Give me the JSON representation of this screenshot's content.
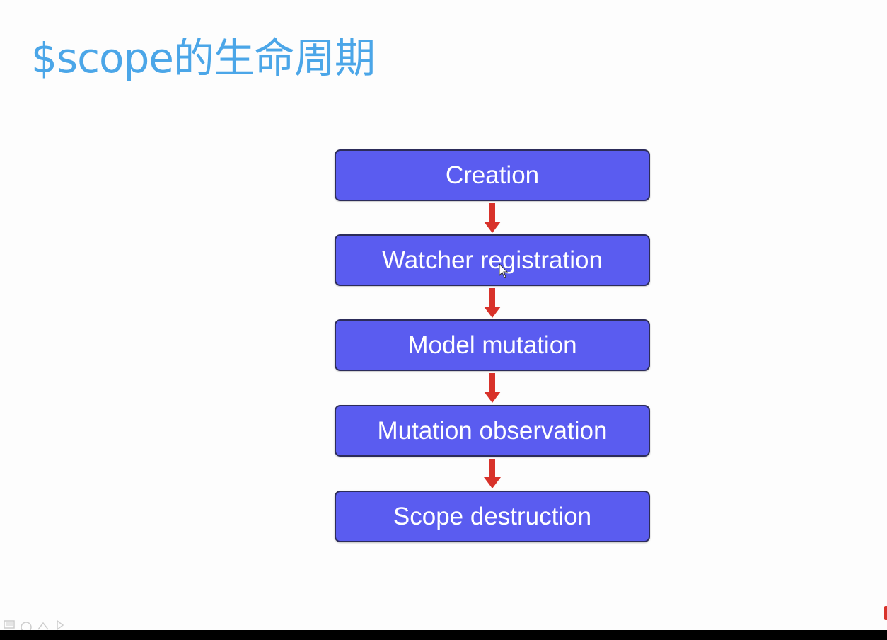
{
  "slide": {
    "title": "$scope的生命周期"
  },
  "flow": {
    "steps": [
      {
        "label": "Creation"
      },
      {
        "label": "Watcher registration"
      },
      {
        "label": "Model mutation"
      },
      {
        "label": "Mutation observation"
      },
      {
        "label": "Scope destruction"
      }
    ],
    "colors": {
      "box_fill": "#5a5cf0",
      "box_border": "#2c2c5a",
      "arrow": "#d8322a",
      "title": "#4ba6e8"
    }
  },
  "toolbar": {
    "icons": [
      "menu-icon",
      "pen-icon",
      "eraser-icon",
      "pointer-icon"
    ]
  }
}
